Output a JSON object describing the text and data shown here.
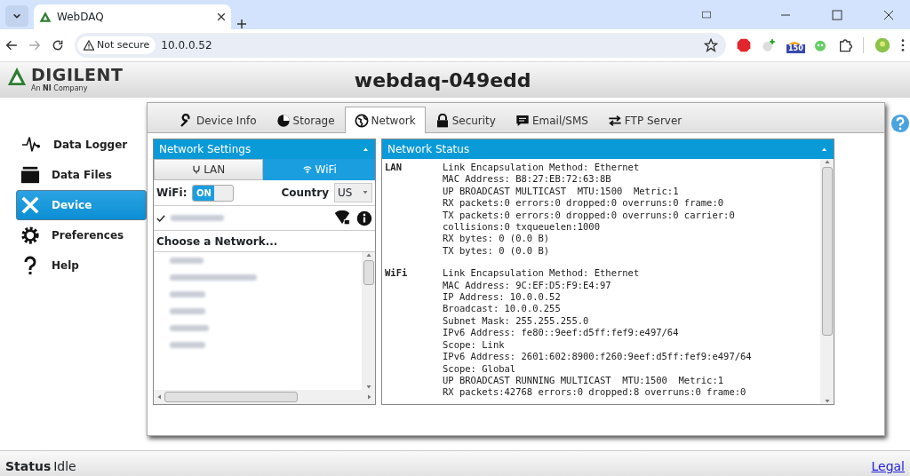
{
  "browser": {
    "tab_title": "WebDAQ",
    "security": "Not secure",
    "url": "10.0.0.52",
    "extension_badge": "150"
  },
  "header": {
    "logo": "DIGILENT",
    "logo_sub": "An **NI** Company",
    "title": "webdaq-049edd"
  },
  "sidebar": {
    "items": [
      {
        "label": "Data Logger",
        "selected": false
      },
      {
        "label": "Data Files",
        "selected": false
      },
      {
        "label": "Device",
        "selected": true
      },
      {
        "label": "Preferences",
        "selected": false
      },
      {
        "label": "Help",
        "selected": false
      }
    ]
  },
  "tabs": [
    {
      "label": "Device Info",
      "selected": false
    },
    {
      "label": "Storage",
      "selected": false
    },
    {
      "label": "Network",
      "selected": true
    },
    {
      "label": "Security",
      "selected": false
    },
    {
      "label": "Email/SMS",
      "selected": false
    },
    {
      "label": "FTP Server",
      "selected": false
    }
  ],
  "network_settings": {
    "title": "Network Settings",
    "modes": [
      {
        "label": "LAN",
        "selected": false
      },
      {
        "label": "WiFi",
        "selected": true
      }
    ],
    "wifi_label": "WiFi:",
    "wifi_switch": {
      "label": "ON",
      "on": true
    },
    "country_label": "Country",
    "country": "US",
    "connected": {
      "checked": true
    },
    "choose_heading": "Choose a Network..."
  },
  "network_status": {
    "title": "Network Status",
    "sections": [
      {
        "name": "LAN",
        "lines": [
          "Link Encapsulation Method: Ethernet",
          "MAC Address: B8:27:EB:72:63:8B",
          "UP BROADCAST MULTICAST  MTU:1500  Metric:1",
          "RX packets:0 errors:0 dropped:0 overruns:0 frame:0",
          "TX packets:0 errors:0 dropped:0 overruns:0 carrier:0",
          "collisions:0 txqueuelen:1000",
          "RX bytes: 0 (0.0 B)",
          "TX bytes: 0 (0.0 B)"
        ]
      },
      {
        "name": "WiFi",
        "lines": [
          "Link Encapsulation Method: Ethernet",
          "MAC Address: 9C:EF:D5:F9:E4:97",
          "IP Address: 10.0.0.52",
          "Broadcast: 10.0.0.255",
          "Subnet Mask: 255.255.255.0",
          "IPv6 Address: fe80::9eef:d5ff:fef9:e497/64",
          "Scope: Link",
          "IPv6 Address: 2601:602:8900:f260:9eef:d5ff:fef9:e497/64",
          "Scope: Global",
          "UP BROADCAST RUNNING MULTICAST  MTU:1500  Metric:1",
          "RX packets:42768 errors:0 dropped:8 overruns:0 frame:0"
        ]
      }
    ]
  },
  "status_bar": {
    "label": "Status",
    "value": "Idle",
    "link": "Legal"
  }
}
